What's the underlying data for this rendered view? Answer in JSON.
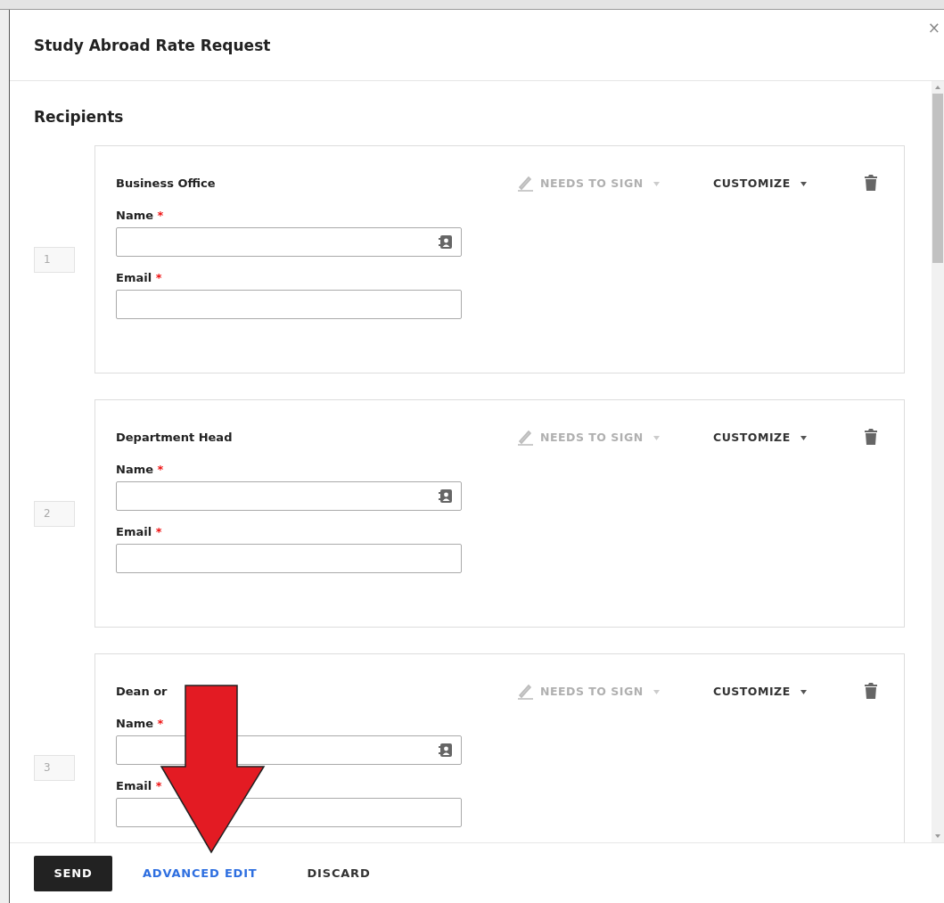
{
  "dialog": {
    "title": "Study Abroad Rate Request",
    "close": "×"
  },
  "section_title": "Recipients",
  "recipients": [
    {
      "order": "1",
      "role": "Business Office",
      "action": "NEEDS TO SIGN",
      "action_disabled": true,
      "customize": "CUSTOMIZE",
      "fields": [
        {
          "label": "Name",
          "required_mark": "*",
          "kind": "contact"
        },
        {
          "label": "Email",
          "required_mark": "*",
          "kind": "text"
        }
      ]
    },
    {
      "order": "2",
      "role": "Department Head",
      "action": "NEEDS TO SIGN",
      "action_disabled": true,
      "customize": "CUSTOMIZE",
      "fields": [
        {
          "label": "Name",
          "required_mark": "*",
          "kind": "contact"
        },
        {
          "label": "Email",
          "required_mark": "*",
          "kind": "text"
        }
      ]
    },
    {
      "order": "3",
      "role": "Dean or",
      "action": "NEEDS TO SIGN",
      "action_disabled": true,
      "customize": "CUSTOMIZE",
      "fields": [
        {
          "label": "Name",
          "required_mark": "*",
          "kind": "contact"
        },
        {
          "label": "Email",
          "required_mark": "*",
          "kind": "text"
        }
      ]
    }
  ],
  "footer": {
    "buttons": [
      {
        "label": "SEND",
        "kind": "primary"
      },
      {
        "label": "ADVANCED EDIT",
        "kind": "link"
      },
      {
        "label": "DISCARD",
        "kind": "plain"
      }
    ]
  },
  "annotation": {
    "kind": "arrow"
  }
}
